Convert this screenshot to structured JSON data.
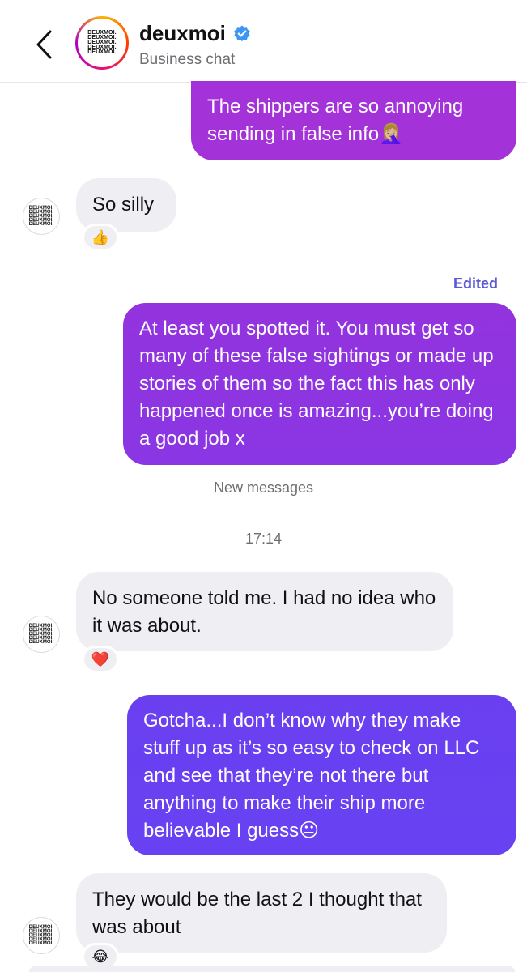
{
  "header": {
    "back_icon": "chevron-left-icon",
    "name": "deuxmoi",
    "verified_icon": "verified-badge-icon",
    "subtitle": "Business chat",
    "logo_lines": [
      "DEUXMOI.",
      "DEUXMOI.",
      "DEUXMOI.",
      "DEUXMOI.",
      "DEUXMOI."
    ]
  },
  "messages": {
    "m1": {
      "text": "The shippers are so annoying sending in false info🤦🏼‍♀️"
    },
    "m2": {
      "text": "So silly",
      "reaction": "👍"
    },
    "m3": {
      "edited": "Edited",
      "text": "At least you spotted it. You must get so many of these false sightings or made up stories of them so the fact this has only happened once is amazing...you’re doing a good job x"
    },
    "m4": {
      "text": "No someone told me. I had no idea who it was about.",
      "reaction": "❤️"
    },
    "m5": {
      "text": "Gotcha...I don’t know why they make stuff up as it’s so easy to check on LLC and see that they’re not there but anything to make their ship more believable I guess😐"
    },
    "m6": {
      "text": "They would be the last 2 I thought that was about",
      "reaction": "😂"
    }
  },
  "divider": {
    "label": "New messages"
  },
  "timestamp": "17:14",
  "colors": {
    "outgoing_top": "#a332d8",
    "outgoing_mid": "#8a35e4",
    "outgoing_bottom": "#6a3ff0",
    "incoming": "#efeff3",
    "edited": "#5a59d6"
  }
}
